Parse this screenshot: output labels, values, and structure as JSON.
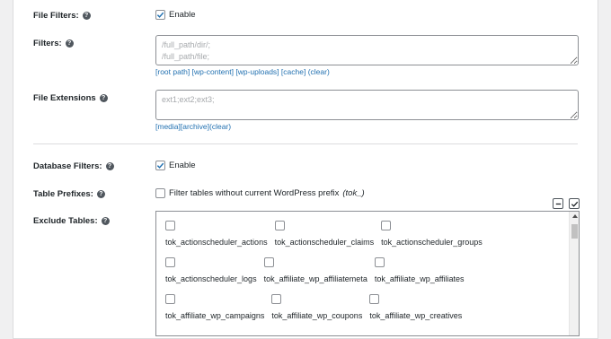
{
  "file_filters": {
    "label": "File Filters:",
    "checkbox_label": "Enable",
    "checked": true
  },
  "filters": {
    "label": "Filters:",
    "placeholder": "/full_path/dir/;\n/full_path/file;",
    "links": [
      "[root path]",
      "[wp-content]",
      "[wp-uploads]",
      "[cache]",
      "(clear)"
    ]
  },
  "file_extensions": {
    "label": "File Extensions",
    "placeholder": "ext1;ext2;ext3;",
    "links": [
      "[media]",
      "[archive]",
      "(clear)"
    ]
  },
  "database_filters": {
    "label": "Database Filters:",
    "checkbox_label": "Enable",
    "checked": true
  },
  "table_prefixes": {
    "label": "Table Prefixes:",
    "checkbox_label": "Filter tables without current WordPress prefix",
    "prefix": "(tok_)",
    "checked": false
  },
  "exclude_tables": {
    "label": "Exclude Tables:",
    "rows": [
      [
        "tok_actionscheduler_actions",
        "tok_actionscheduler_claims",
        "tok_actionscheduler_groups"
      ],
      [
        "tok_actionscheduler_logs",
        "tok_affiliate_wp_affiliatemeta",
        "tok_affiliate_wp_affiliates"
      ],
      [
        "tok_affiliate_wp_campaigns",
        "tok_affiliate_wp_coupons",
        "tok_affiliate_wp_creatives"
      ]
    ]
  },
  "colors": {
    "link": "#2271b1",
    "check": "#2271b1"
  }
}
